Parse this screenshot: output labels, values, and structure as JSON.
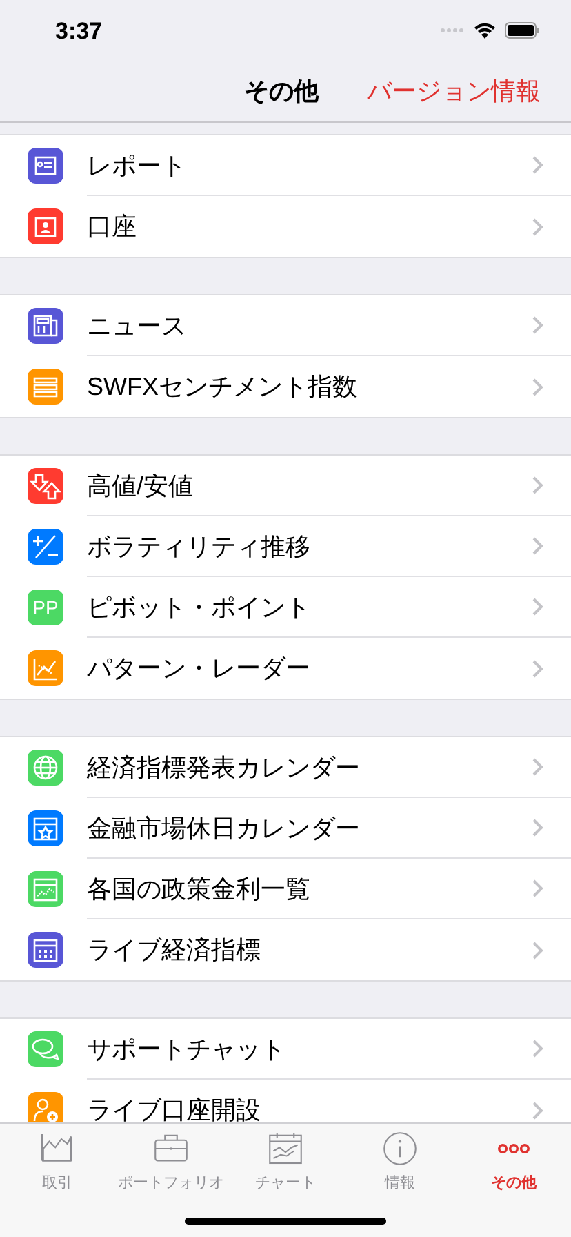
{
  "status_bar": {
    "time": "3:37"
  },
  "nav_bar": {
    "title": "その他",
    "action": "バージョン情報"
  },
  "sections": [
    {
      "items": [
        {
          "label": "レポート",
          "kind": "report",
          "color": "#5856d6"
        },
        {
          "label": "口座",
          "kind": "account",
          "color": "#ff3b30"
        }
      ]
    },
    {
      "items": [
        {
          "label": "ニュース",
          "kind": "news",
          "color": "#5856d6"
        },
        {
          "label": "SWFXセンチメント指数",
          "kind": "bars",
          "color": "#ff9500"
        }
      ]
    },
    {
      "items": [
        {
          "label": "高値/安値",
          "kind": "arrows",
          "color": "#ff3b30"
        },
        {
          "label": "ボラティリティ推移",
          "kind": "plusminus",
          "color": "#007aff"
        },
        {
          "label": "ピボット・ポイント",
          "kind": "text",
          "icon_text": "PP",
          "color": "#4cd964"
        },
        {
          "label": "パターン・レーダー",
          "kind": "pattern",
          "color": "#ff9500"
        }
      ]
    },
    {
      "items": [
        {
          "label": "経済指標発表カレンダー",
          "kind": "globe",
          "color": "#4cd964"
        },
        {
          "label": "金融市場休日カレンダー",
          "kind": "calstar",
          "color": "#007aff"
        },
        {
          "label": "各国の政策金利一覧",
          "kind": "calchart",
          "color": "#4cd964"
        },
        {
          "label": "ライブ経済指標",
          "kind": "caldots",
          "color": "#5856d6"
        }
      ]
    },
    {
      "items": [
        {
          "label": "サポートチャット",
          "kind": "chat",
          "color": "#4cd964"
        },
        {
          "label": "ライブ口座開設",
          "kind": "person",
          "color": "#ff9500"
        }
      ]
    }
  ],
  "tab_bar": [
    {
      "label": "取引",
      "kind": "trade",
      "selected": false
    },
    {
      "label": "ポートフォリオ",
      "kind": "briefcase",
      "selected": false
    },
    {
      "label": "チャート",
      "kind": "chart",
      "selected": false
    },
    {
      "label": "情報",
      "kind": "info",
      "selected": false
    },
    {
      "label": "その他",
      "kind": "more",
      "selected": true
    }
  ]
}
